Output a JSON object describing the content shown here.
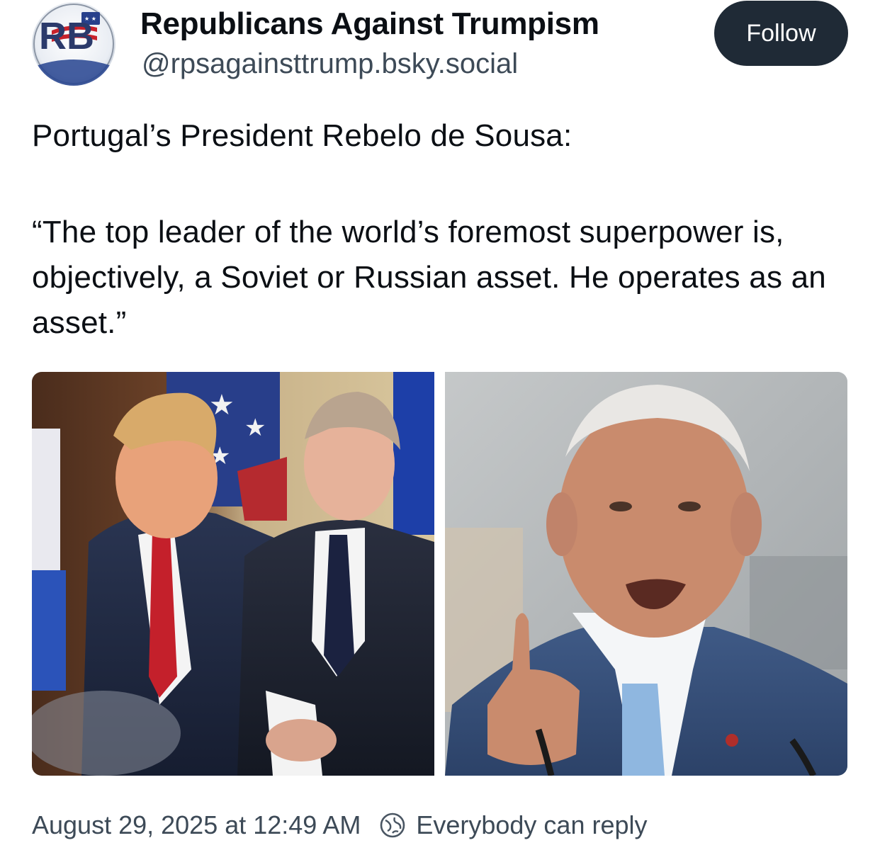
{
  "author": {
    "avatar_monogram": "RB",
    "display_name": "Republicans Against Trumpism",
    "handle": "@rpsagainsttrump.bsky.social"
  },
  "follow_button_label": "Follow",
  "post": {
    "line_1": "Portugal’s President Rebelo de Sousa:",
    "quote": "“The top leader of the world’s foremost superpower is, objectively, a Soviet or Russian asset. He operates as an asset.”"
  },
  "images": {
    "left": "photo-two-leaders",
    "right": "photo-speaking-man"
  },
  "footer": {
    "timestamp": "August 29, 2025 at 12:49 AM",
    "reply_setting": "Everybody can reply",
    "reply_icon": "globe-icon"
  },
  "colors": {
    "follow_bg": "#1f2a36",
    "muted_text": "#3d4a57",
    "text": "#0b0f14"
  }
}
